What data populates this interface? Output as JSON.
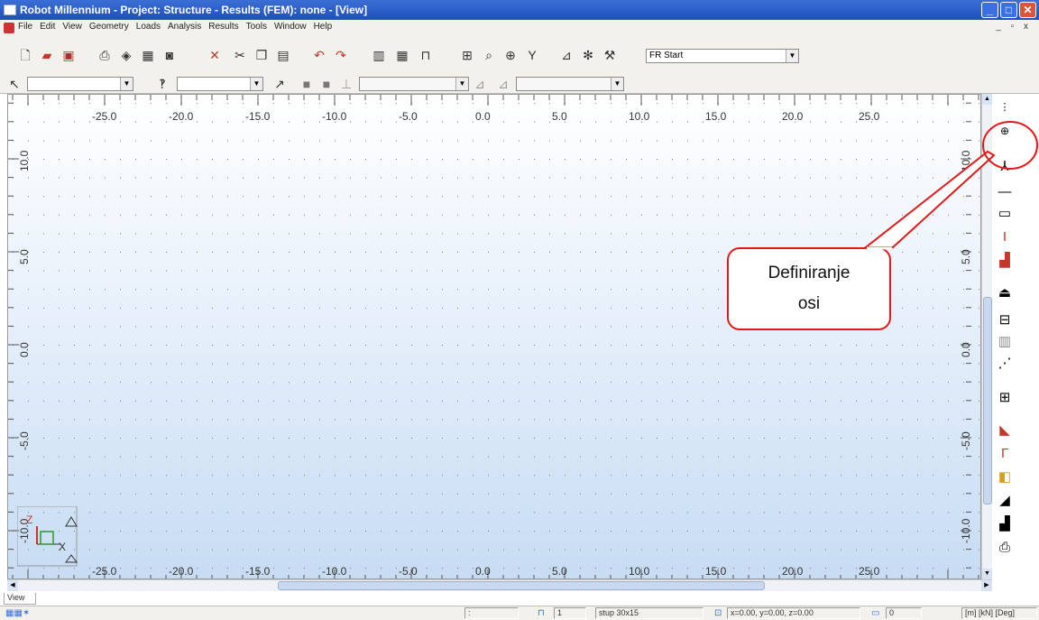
{
  "window": {
    "title": "Robot Millennium - Project: Structure - Results (FEM): none - [View]",
    "min_label": "_",
    "max_label": "□",
    "close_label": "✕"
  },
  "menu": {
    "items": [
      "File",
      "Edit",
      "View",
      "Geometry",
      "Loads",
      "Analysis",
      "Results",
      "Tools",
      "Window",
      "Help"
    ],
    "mdi_controls": "_ ▫ x"
  },
  "toolbar": {
    "layout_combo_value": "FR Start",
    "toolbar1_icons": [
      "new-file-icon",
      "open-icon",
      "save-icon",
      "print-icon",
      "preview-icon",
      "screen-capture-icon",
      "camera-icon",
      "delete-icon",
      "cut-icon",
      "copy-icon",
      "paste-icon",
      "undo-icon",
      "redo-icon",
      "table-icon",
      "structure-icon",
      "lock-icon",
      "calc-icon",
      "zoom-icon",
      "zoom-window-icon",
      "filter-icon",
      "results-icon",
      "settings-icon",
      "wrench-icon"
    ]
  },
  "viewport": {
    "x_ticks": [
      "-25.0",
      "-20.0",
      "-15.0",
      "-10.0",
      "-5.0",
      "0.0",
      "5.0",
      "10.0",
      "15.0",
      "20.0",
      "25.0"
    ],
    "y_ticks": [
      "10.0",
      "5.0",
      "0.0",
      "-5.0",
      "-10.0"
    ],
    "axis_z": "Z",
    "axis_x": "X",
    "background_top": "#ffffff",
    "background_bottom": "#c7dcf3"
  },
  "callout": {
    "line1": "Definiranje",
    "line2": "osi",
    "border_color": "#e31919"
  },
  "right_toolbar": {
    "icons": [
      "more-icon",
      "axis-definition-icon",
      "nodes-icon",
      "bars-icon",
      "section-icon",
      "i-beam-icon",
      "materials-icon",
      "supports-icon",
      "releases-icon",
      "panels-icon",
      "offsets-icon",
      "frame-icon",
      "brackets-icon",
      "shapes-icon",
      "solid-icon",
      "load-icon",
      "cladding-icon",
      "printer-icon"
    ]
  },
  "bottom": {
    "view_tab": "View"
  },
  "statusbar": {
    "field1": ":",
    "field2": "1",
    "section": "stup 30x15",
    "coordinates": "x=0.00, y=0.00, z=0.00",
    "counter": "0",
    "units": "[m] [kN] [Deg]"
  }
}
